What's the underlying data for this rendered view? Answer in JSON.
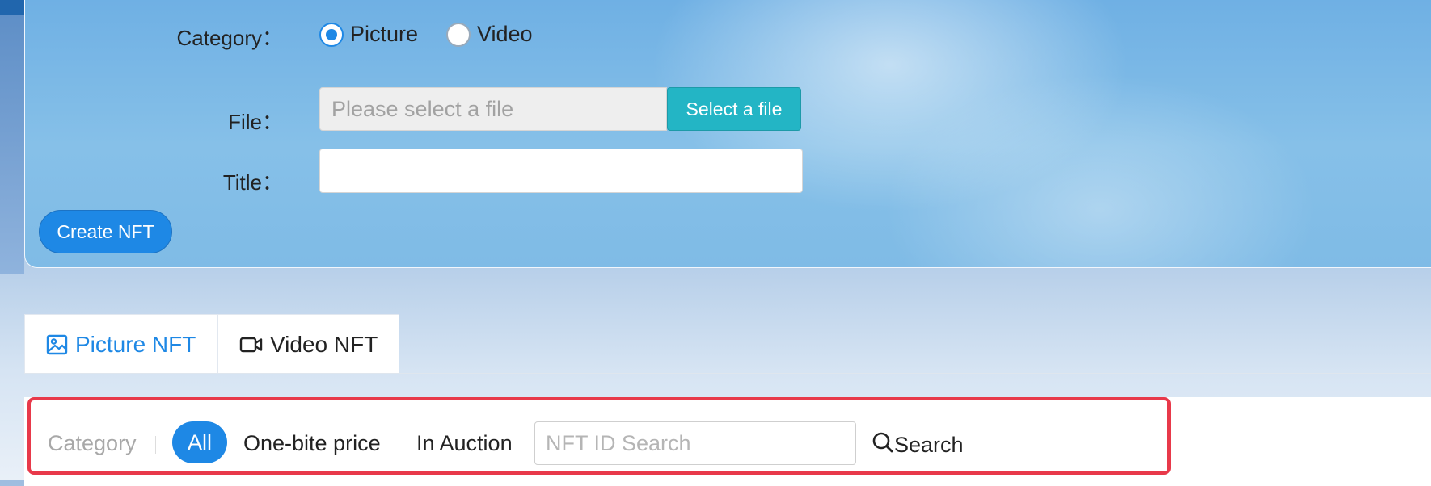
{
  "form": {
    "category_label": "Category：",
    "category_options": [
      "Picture",
      "Video"
    ],
    "selected_category": "Picture",
    "file_label": "File：",
    "file_placeholder": "Please select a file",
    "select_file_button": "Select a file",
    "title_label": "Title：",
    "title_value": "",
    "create_button": "Create NFT"
  },
  "tabs": [
    {
      "label": "Picture NFT",
      "icon": "image-icon",
      "active": true
    },
    {
      "label": "Video NFT",
      "icon": "video-camera-icon",
      "active": false
    }
  ],
  "filter": {
    "category_label": "Category",
    "options": [
      "All",
      "One-bite price",
      "In Auction"
    ],
    "selected": "All",
    "search_placeholder": "NFT ID Search",
    "search_button": "Search"
  },
  "colors": {
    "accent": "#1e88e5",
    "file_button": "#23b5c5",
    "top_bar": "#2166ad",
    "highlight_border": "#e8394a"
  }
}
